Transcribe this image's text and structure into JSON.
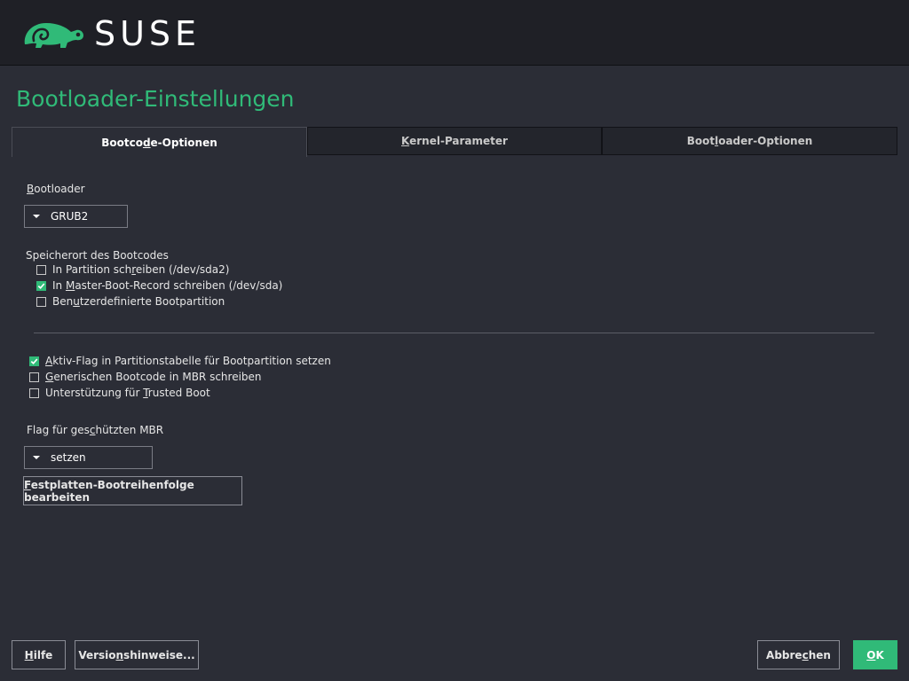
{
  "header": {
    "brand": "SUSE",
    "logo_icon": "chameleon-icon"
  },
  "page": {
    "title": "Bootloader-Einstellungen"
  },
  "tabs": [
    {
      "pre": "Bootco",
      "mn": "d",
      "post": "e-Optionen",
      "active": true
    },
    {
      "pre": "",
      "mn": "K",
      "post": "ernel-Parameter",
      "active": false
    },
    {
      "pre": "Boot",
      "mn": "l",
      "post": "oader-Optionen",
      "active": false
    }
  ],
  "bootloader": {
    "label_pre": "",
    "label_mn": "B",
    "label_post": "ootloader",
    "selected": "GRUB2"
  },
  "location": {
    "label": "Speicherort des Bootcodes",
    "options": [
      {
        "pre": "In Partition sch",
        "mn": "r",
        "post": "eiben (/dev/sda2)",
        "checked": false
      },
      {
        "pre": "In ",
        "mn": "M",
        "post": "aster-Boot-Record schreiben (/dev/sda)",
        "checked": true
      },
      {
        "pre": "Ben",
        "mn": "u",
        "post": "tzerdefinierte Bootpartition",
        "checked": false
      }
    ]
  },
  "flags": {
    "options": [
      {
        "pre": "",
        "mn": "A",
        "post": "ktiv-Flag in Partitionstabelle für Bootpartition setzen",
        "checked": true
      },
      {
        "pre": "",
        "mn": "G",
        "post": "enerischen Bootcode in MBR schreiben",
        "checked": false
      },
      {
        "pre": "Unterstützung für ",
        "mn": "T",
        "post": "rusted Boot",
        "checked": false
      }
    ]
  },
  "protective_mbr": {
    "label_pre": "Flag für ges",
    "label_mn": "c",
    "label_post": "hützten MBR",
    "selected": "setzen"
  },
  "disk_order_button": {
    "pre": "",
    "mn": "F",
    "post": "estplatten-Bootreihenfolge bearbeiten"
  },
  "footer": {
    "help": {
      "pre": "",
      "mn": "H",
      "post": "ilfe"
    },
    "release_notes": {
      "pre": "Versio",
      "mn": "n",
      "post": "shinweise..."
    },
    "cancel": {
      "pre": "Abbre",
      "mn": "c",
      "post": "hen"
    },
    "ok": {
      "pre": "",
      "mn": "O",
      "post": "K"
    }
  },
  "colors": {
    "accent": "#30ba78",
    "background": "#2b2d36",
    "header": "#1f2026"
  }
}
